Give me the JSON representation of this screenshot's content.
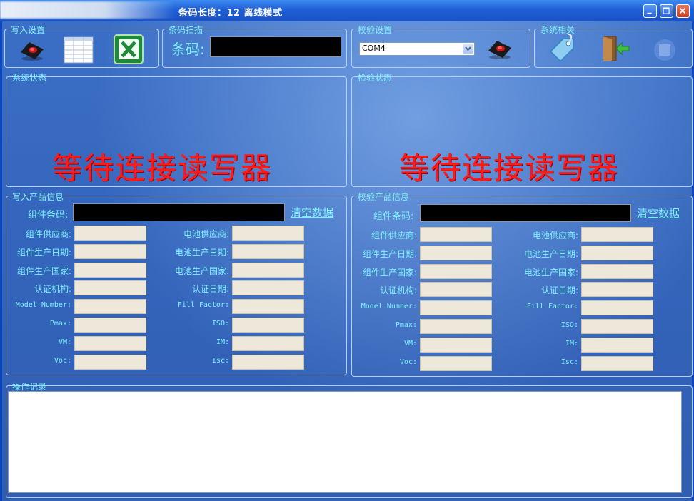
{
  "window": {
    "title": "条码长度：12 离线模式",
    "colors": {
      "titlebar": "#1f5fd6",
      "accent_text": "#7ff0ff",
      "status_text": "#ff1a1a"
    }
  },
  "toolbar": {
    "write_settings": {
      "legend": "写入设置",
      "icons": [
        "rfid-reader-icon",
        "table-grid-icon",
        "excel-icon"
      ]
    },
    "barcode_scan": {
      "legend": "条码扫描",
      "label": "条码:",
      "value": ""
    },
    "verify_settings": {
      "legend": "校验设置",
      "port_selected": "COM4",
      "icons": [
        "rfid-reader-icon"
      ]
    },
    "system_related": {
      "legend": "系统相关",
      "icons": [
        "tag-icon",
        "exit-door-icon",
        "stop-icon"
      ]
    }
  },
  "system_status": {
    "legend": "系统状态",
    "message": "等待连接读写器"
  },
  "verify_status": {
    "legend": "检验状态",
    "message": "等待连接读写器"
  },
  "write_product": {
    "legend": "写入产品信息",
    "barcode_label": "组件条码:",
    "clear_label": "清空数据",
    "left_fields": [
      "组件供应商:",
      "组件生产日期:",
      "组件生产国家:",
      "认证机构:",
      "Model Number:",
      "Pmax:",
      "VM:",
      "Voc:"
    ],
    "right_fields": [
      "电池供应商:",
      "电池生产日期:",
      "电池生产国家:",
      "认证日期:",
      "Fill Factor:",
      "ISO:",
      "IM:",
      "Isc:"
    ]
  },
  "verify_product": {
    "legend": "校验产品信息",
    "barcode_label": "组件条码:",
    "clear_label": "清空数据",
    "left_fields": [
      "组件供应商:",
      "组件生产日期:",
      "组件生产国家:",
      "认证机构:",
      "Model Number:",
      "Pmax:",
      "VM:",
      "Voc:"
    ],
    "right_fields": [
      "电池供应商:",
      "电池生产日期:",
      "电池生产国家:",
      "认证日期:",
      "Fill Factor:",
      "ISO:",
      "IM:",
      "Isc:"
    ]
  },
  "operation_log": {
    "legend": "操作记录",
    "content": ""
  }
}
